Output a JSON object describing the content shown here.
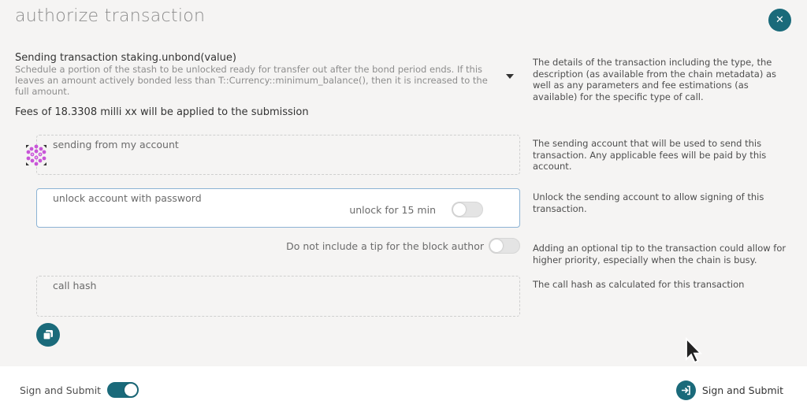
{
  "modal": {
    "title": "authorize transaction",
    "close_icon": "close-icon"
  },
  "transaction": {
    "method": "Sending transaction staking.unbond(value)",
    "description": "Schedule a portion of the stash to be unlocked ready for transfer out after the bond period ends. If this leaves an amount actively bonded less than T::Currency::minimum_balance(), then it is increased to the full amount.",
    "fees": "Fees of 18.3308 milli xx will be applied to the submission"
  },
  "help": {
    "details": "The details of the transaction including the type, the description (as available from the chain metadata) as well as any parameters and fee estimations (as available) for the specific type of call.",
    "sending": "The sending account that will be used to send this transaction. Any applicable fees will be paid by this account.",
    "unlock": "Unlock the sending account to allow signing of this transaction.",
    "tip": "Adding an optional tip to the transaction could allow for higher priority, especially when the chain is busy.",
    "callhash": "The call hash as calculated for this transaction"
  },
  "sending_account": {
    "label": "sending from my account"
  },
  "unlock": {
    "label": "unlock account with password",
    "toggle_label": "unlock for 15 min",
    "toggle_on": false
  },
  "tip": {
    "label": "Do not include a tip for the block author",
    "toggle_on": false
  },
  "call_hash": {
    "label": "call hash"
  },
  "footer": {
    "toggle_label": "Sign and Submit",
    "toggle_on": true,
    "submit_label": "Sign and Submit"
  },
  "colors": {
    "accent": "#1a6a7a",
    "background": "#f5f4f3",
    "identicon": "#c855d8"
  }
}
